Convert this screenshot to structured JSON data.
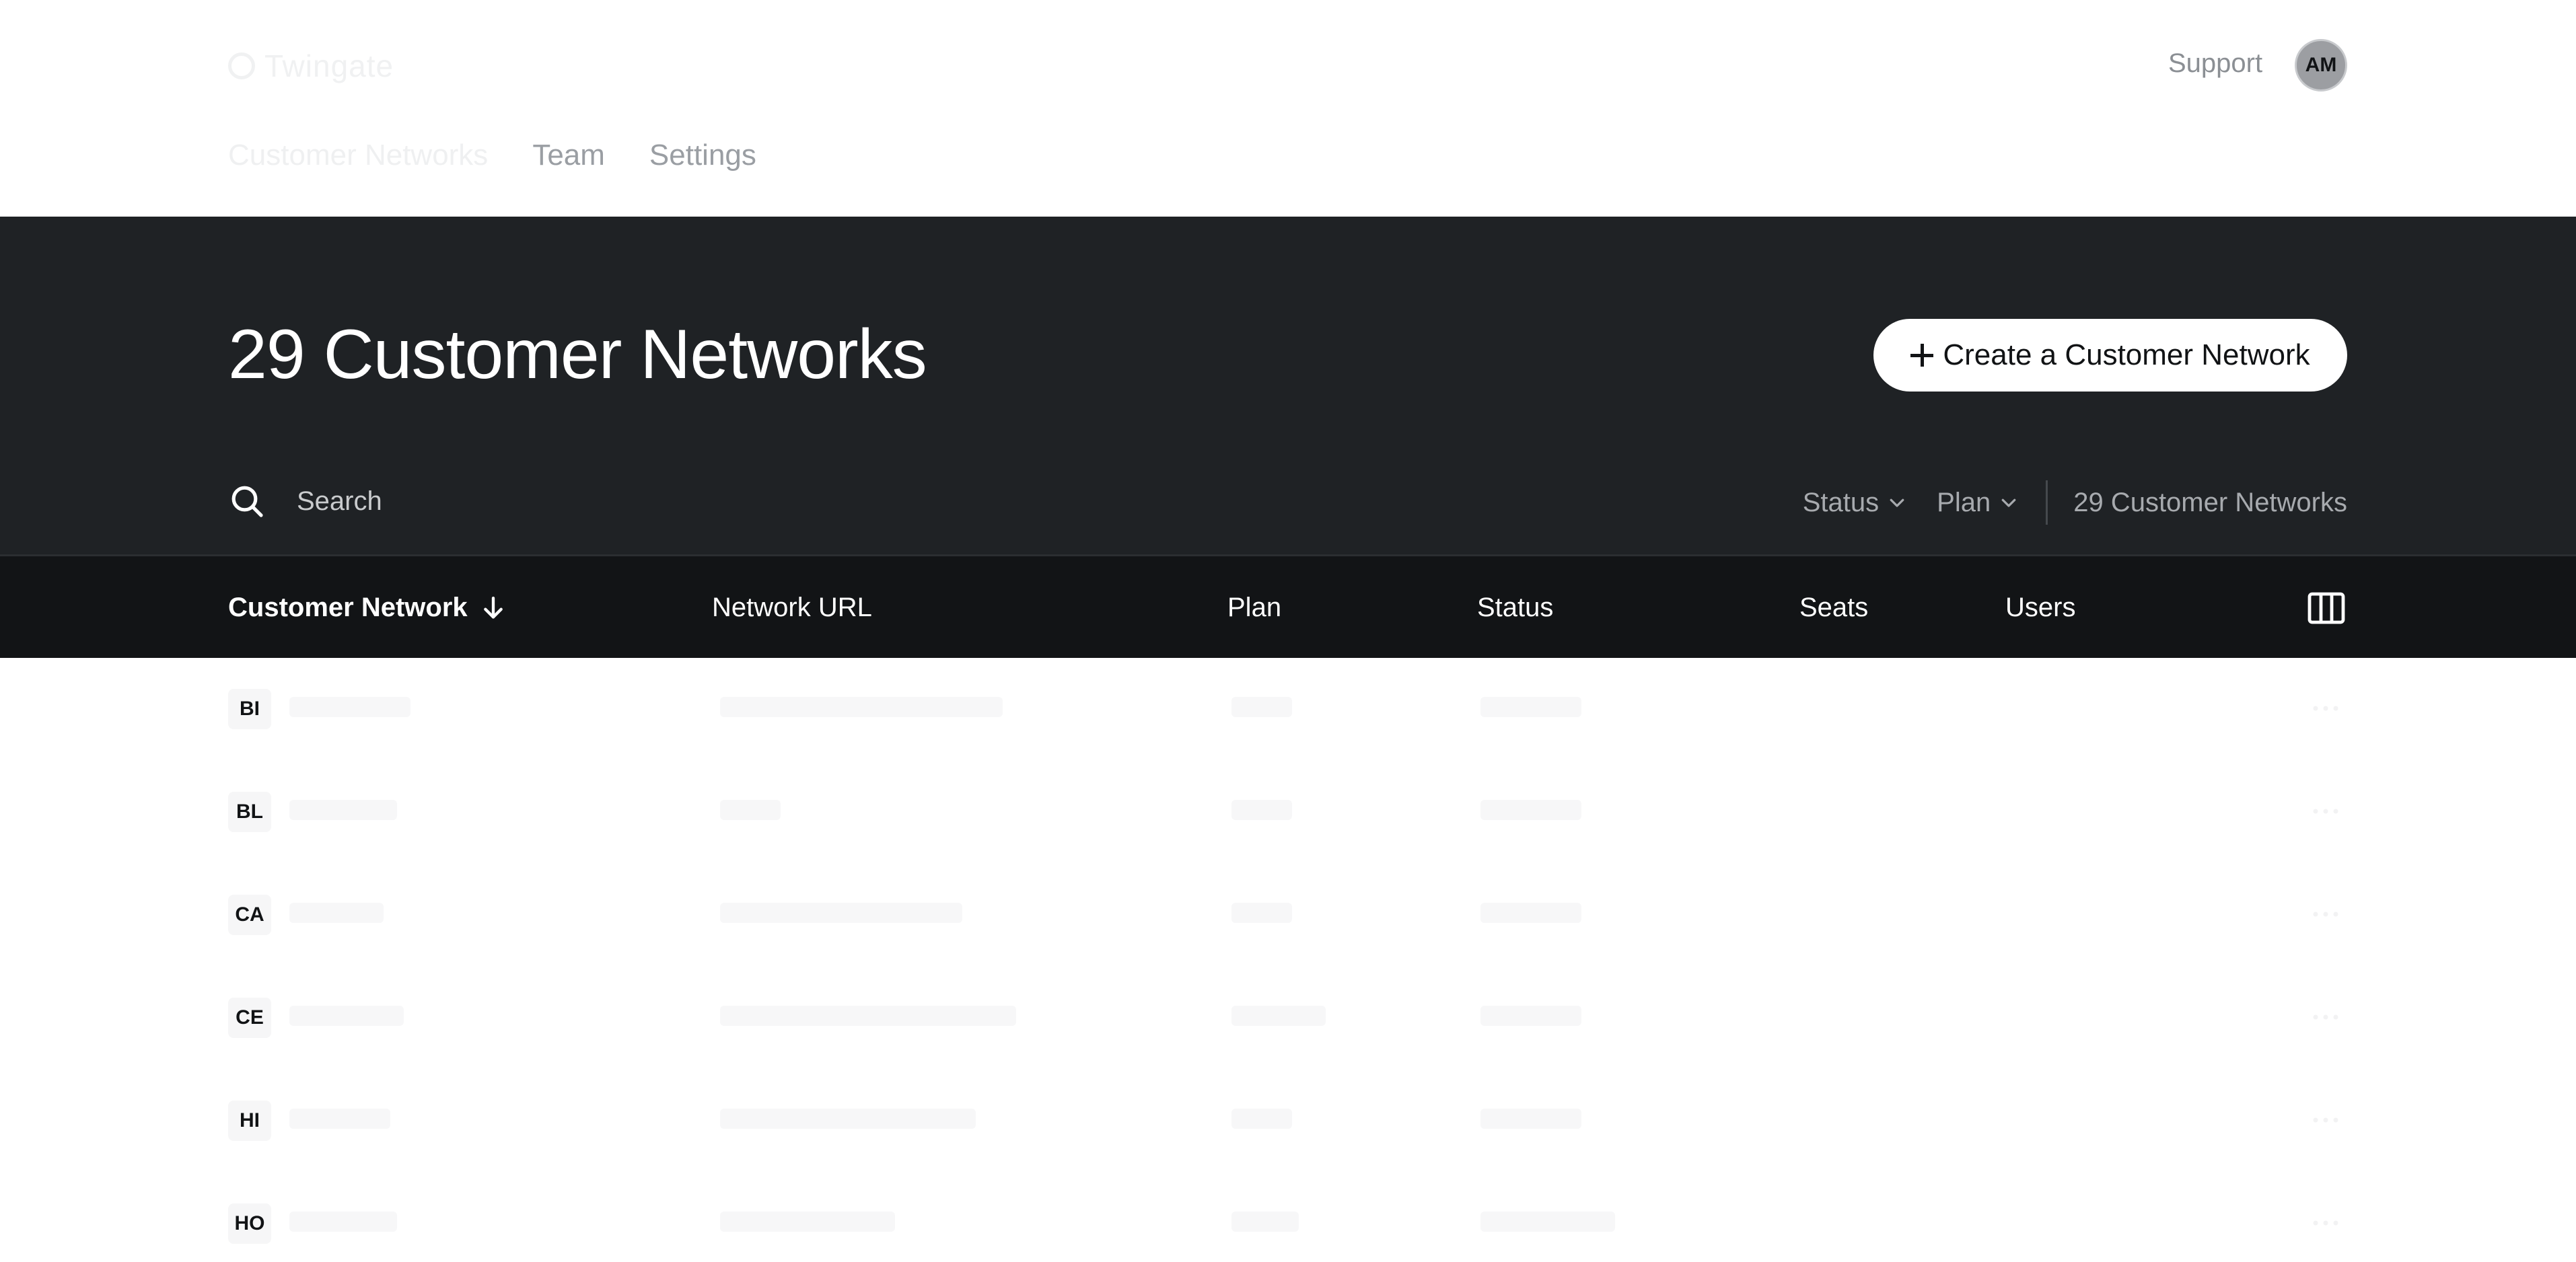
{
  "header": {
    "logo_text": "Twingate",
    "support_label": "Support",
    "avatar_initials": "AM"
  },
  "nav": {
    "items": [
      {
        "label": "Customer Networks",
        "active": true
      },
      {
        "label": "Team",
        "active": false
      },
      {
        "label": "Settings",
        "active": false
      }
    ]
  },
  "hero": {
    "title": "29 Customer Networks",
    "create_button_label": "Create a Customer Network"
  },
  "toolbar": {
    "search_placeholder": "Search",
    "status_filter_label": "Status",
    "plan_filter_label": "Plan",
    "count_label": "29 Customer Networks"
  },
  "table": {
    "columns": {
      "customer_network": "Customer Network",
      "network_url": "Network URL",
      "plan": "Plan",
      "status": "Status",
      "seats": "Seats",
      "users": "Users"
    },
    "rows": [
      {
        "initials": "BI"
      },
      {
        "initials": "BL"
      },
      {
        "initials": "CA"
      },
      {
        "initials": "CE"
      },
      {
        "initials": "HI"
      },
      {
        "initials": "HO"
      }
    ]
  },
  "colors": {
    "hero_background": "#1f2225",
    "table_header_background": "#121416",
    "accent_white": "#ffffff"
  }
}
